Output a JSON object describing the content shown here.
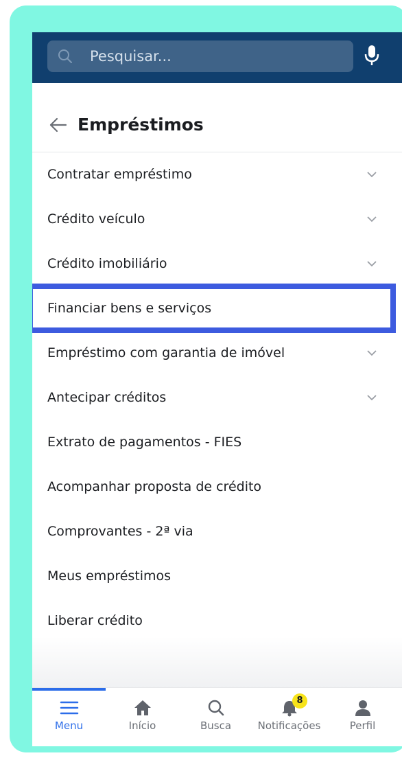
{
  "search": {
    "placeholder": "Pesquisar..."
  },
  "header": {
    "title": "Empréstimos"
  },
  "menu_items": [
    {
      "label": "Contratar empréstimo",
      "has_chevron": true
    },
    {
      "label": "Crédito veículo",
      "has_chevron": true
    },
    {
      "label": "Crédito imobiliário",
      "has_chevron": true
    },
    {
      "label": "Financiar bens e serviços",
      "has_chevron": false,
      "highlighted": true
    },
    {
      "label": "Empréstimo com garantia de imóvel",
      "has_chevron": true
    },
    {
      "label": "Antecipar créditos",
      "has_chevron": true
    },
    {
      "label": "Extrato de pagamentos - FIES",
      "has_chevron": false
    },
    {
      "label": "Acompanhar proposta de crédito",
      "has_chevron": false
    },
    {
      "label": "Comprovantes - 2ª via",
      "has_chevron": false
    },
    {
      "label": "Meus empréstimos",
      "has_chevron": false
    },
    {
      "label": "Liberar crédito",
      "has_chevron": false
    }
  ],
  "bottom_nav": [
    {
      "label": "Menu",
      "icon": "menu-icon",
      "active": true
    },
    {
      "label": "Início",
      "icon": "home-icon",
      "active": false
    },
    {
      "label": "Busca",
      "icon": "search-icon",
      "active": false
    },
    {
      "label": "Notificações",
      "icon": "bell-icon",
      "active": false,
      "badge": "8"
    },
    {
      "label": "Perfil",
      "icon": "profile-icon",
      "active": false
    }
  ],
  "colors": {
    "topbar": "#103f6e",
    "accent": "#2c6de9",
    "highlight_border": "#3d5bdf",
    "frame": "#80f7e2",
    "badge": "#f7e31a"
  }
}
